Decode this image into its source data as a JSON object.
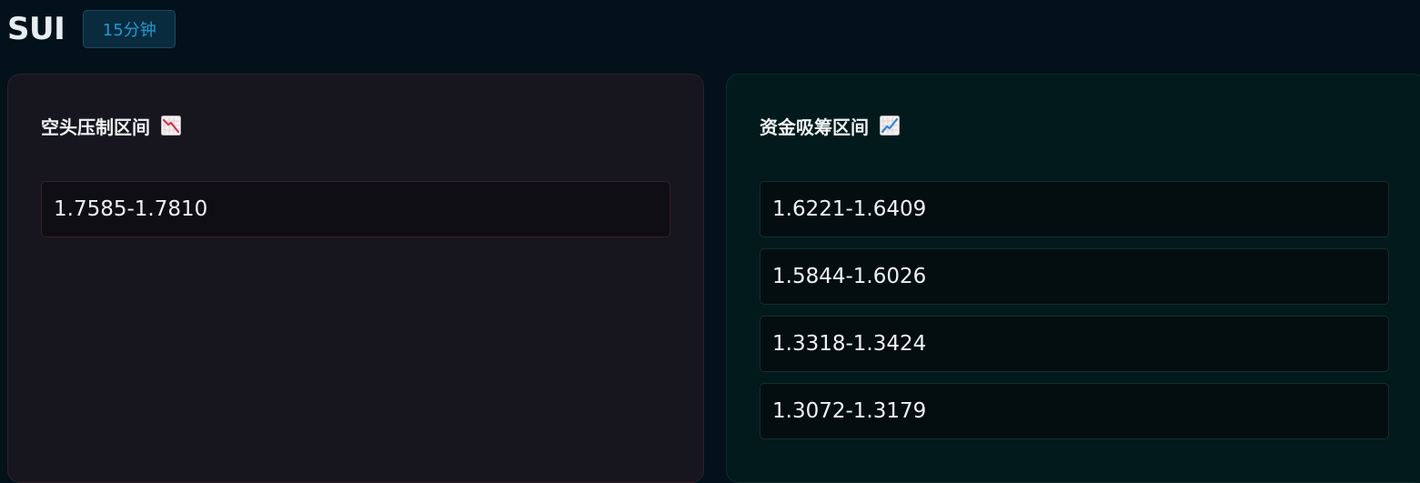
{
  "header": {
    "symbol": "SUI",
    "timeframe": "15分钟"
  },
  "short_panel": {
    "title": "空头压制区间",
    "icon": "chart-decreasing-icon",
    "zones": [
      "1.7585-1.7810"
    ]
  },
  "long_panel": {
    "title": "资金吸筹区间",
    "icon": "chart-increasing-icon",
    "zones": [
      "1.6221-1.6409",
      "1.5844-1.6026",
      "1.3318-1.3424",
      "1.3072-1.3179"
    ]
  },
  "colors": {
    "page_bg": "#02111a",
    "badge_text": "#1a9bd7",
    "short_panel_bg": "#17161e",
    "long_panel_bg": "#031a1c",
    "decrease_red": "#d3344c",
    "increase_blue": "#2f86d8"
  }
}
